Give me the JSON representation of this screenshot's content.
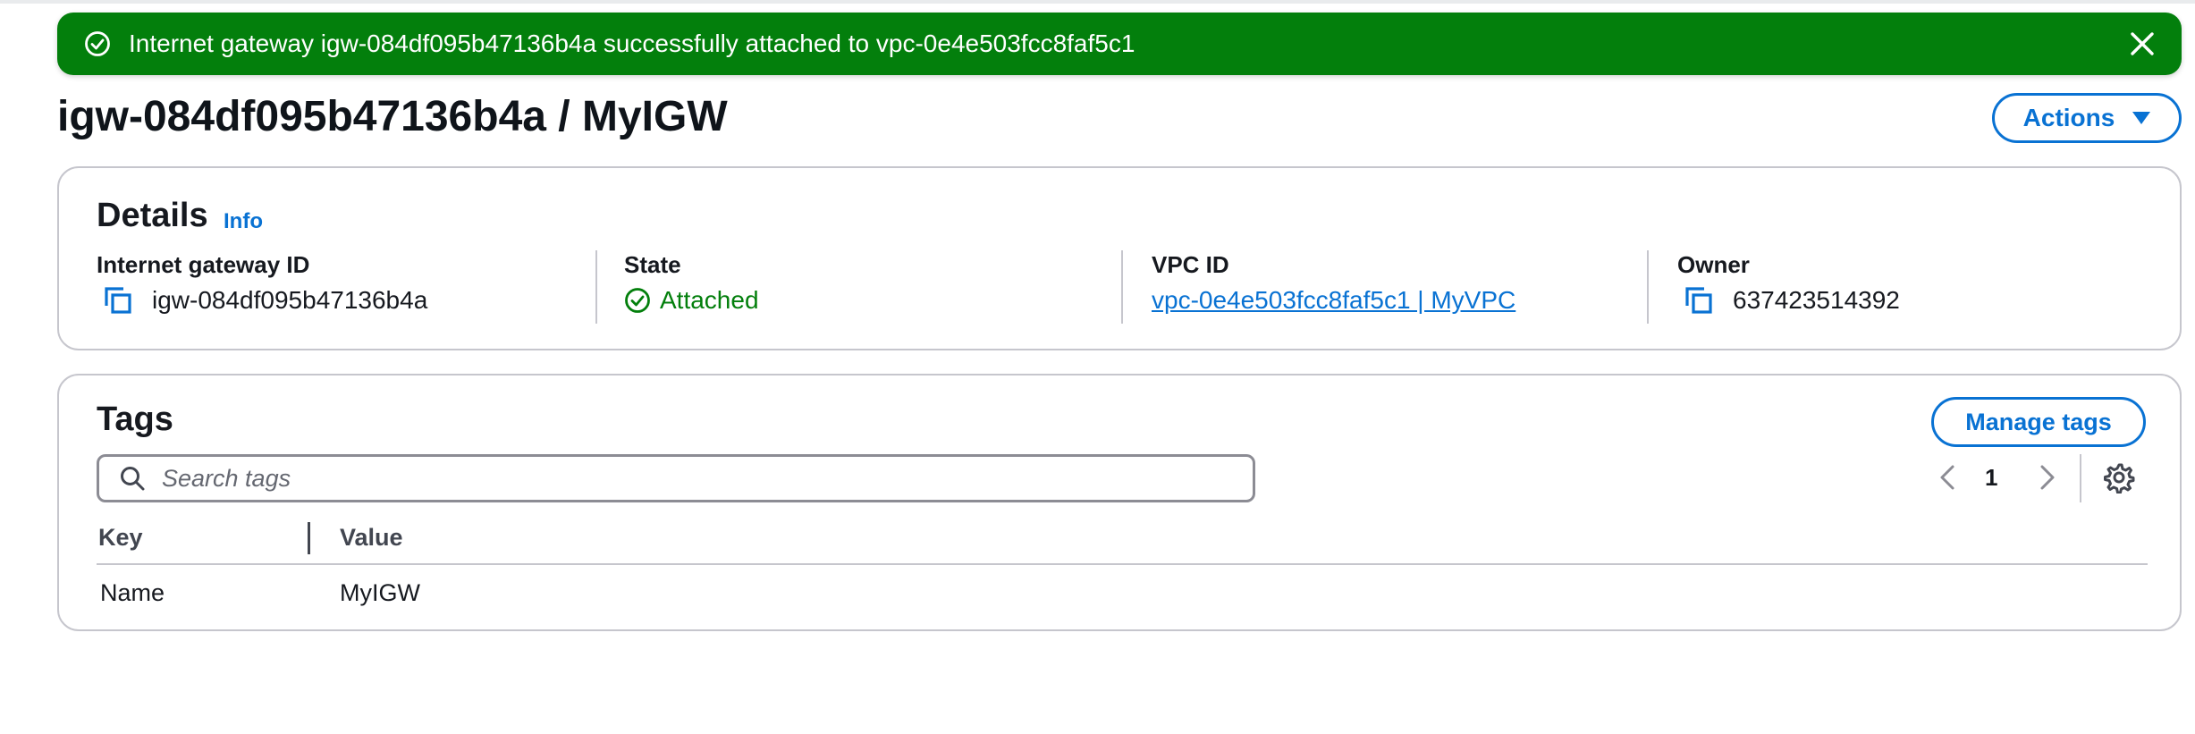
{
  "flash": {
    "message": "Internet gateway igw-084df095b47136b4a successfully attached to vpc-0e4e503fcc8faf5c1",
    "type": "success",
    "color": "#037f0c"
  },
  "header": {
    "title": "igw-084df095b47136b4a / MyIGW",
    "actions_label": "Actions"
  },
  "details": {
    "title": "Details",
    "info_label": "Info",
    "fields": {
      "igw_id": {
        "label": "Internet gateway ID",
        "value": "igw-084df095b47136b4a"
      },
      "state": {
        "label": "State",
        "value": "Attached"
      },
      "vpc_id": {
        "label": "VPC ID",
        "value": "vpc-0e4e503fcc8faf5c1 | MyVPC"
      },
      "owner": {
        "label": "Owner",
        "value": "637423514392"
      }
    }
  },
  "tags": {
    "title": "Tags",
    "manage_label": "Manage tags",
    "search_placeholder": "Search tags",
    "page": "1",
    "columns": {
      "key": "Key",
      "value": "Value"
    },
    "rows": [
      {
        "key": "Name",
        "value": "MyIGW"
      }
    ]
  },
  "colors": {
    "accent": "#0972d3",
    "success": "#037f0c",
    "border": "#c6c6cd"
  }
}
